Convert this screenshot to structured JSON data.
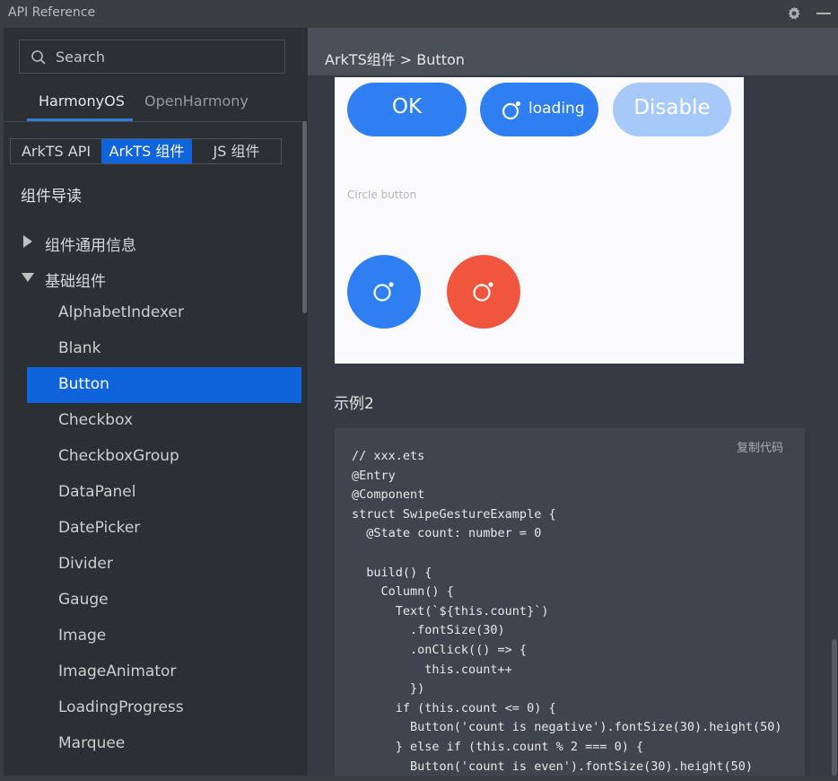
{
  "window": {
    "title": "API Reference"
  },
  "sidebar": {
    "search_placeholder": "Search",
    "os_tabs": [
      "HarmonyOS",
      "OpenHarmony"
    ],
    "segments": [
      "ArkTS API",
      "ArkTS 组件",
      "JS 组件"
    ],
    "section_title": "组件导读",
    "tree": [
      {
        "label": "组件通用信息",
        "expanded": false
      },
      {
        "label": "基础组件",
        "expanded": true
      }
    ],
    "items": [
      "AlphabetIndexer",
      "Blank",
      "Button",
      "Checkbox",
      "CheckboxGroup",
      "DataPanel",
      "DatePicker",
      "Divider",
      "Gauge",
      "Image",
      "ImageAnimator",
      "LoadingProgress",
      "Marquee"
    ],
    "selected_item": "Button"
  },
  "main": {
    "breadcrumb": "ArkTS组件 > Button",
    "preview": {
      "buttons": [
        "OK",
        "loading",
        "Disable"
      ],
      "caption": "Circle button"
    },
    "example_title": "示例2",
    "code": {
      "copy_label": "复制代码",
      "lines": [
        "// xxx.ets",
        "@Entry",
        "@Component",
        "struct SwipeGestureExample {",
        "  @State count: number = 0",
        "",
        "  build() {",
        "    Column() {",
        "      Text(`${this.count}`)",
        "        .fontSize(30)",
        "        .onClick(() => {",
        "          this.count++",
        "        })",
        "      if (this.count <= 0) {",
        "        Button('count is negative').fontSize(30).height(50)",
        "      } else if (this.count % 2 === 0) {",
        "        Button('count is even').fontSize(30).height(50)"
      ]
    }
  },
  "colors": {
    "accent": "#1064db",
    "button_blue": "#2f7ff3",
    "button_disabled": "#a7c9fa",
    "button_red": "#f0553e"
  }
}
